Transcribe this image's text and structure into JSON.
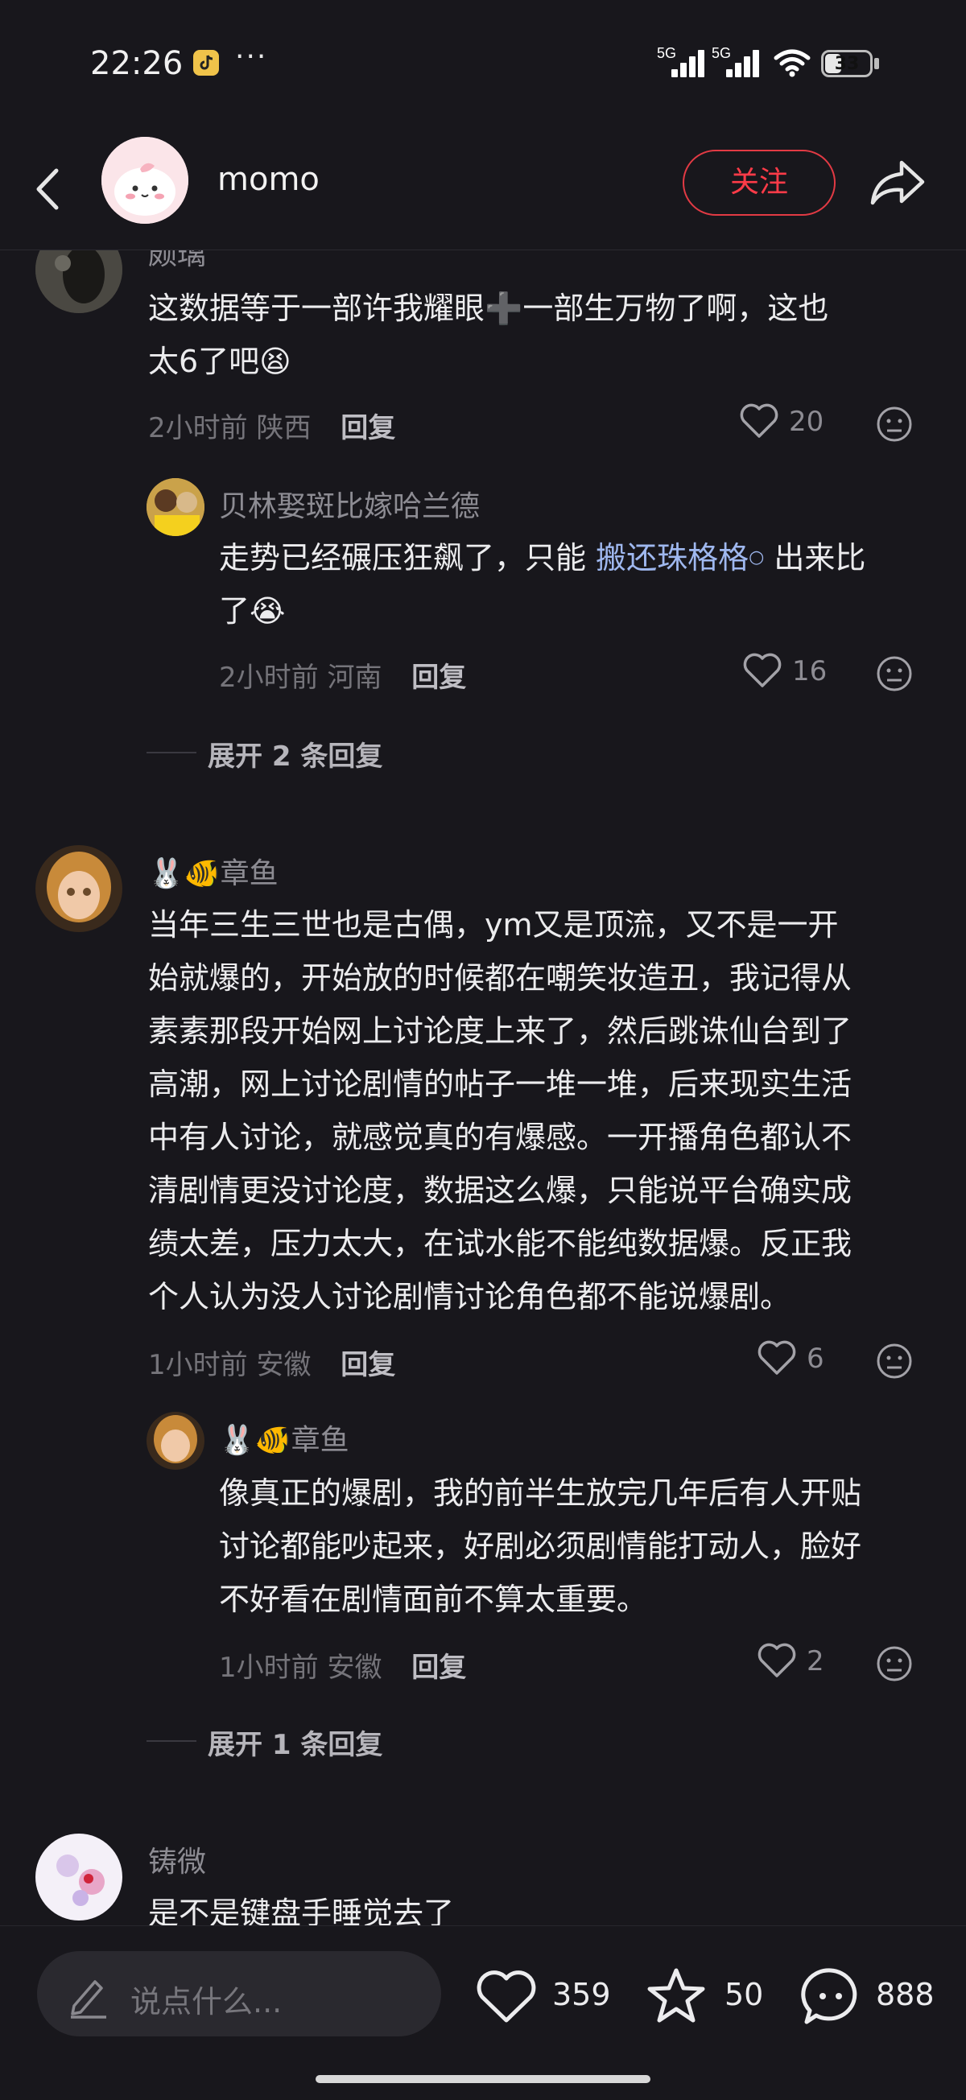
{
  "status_bar": {
    "time": "22:26",
    "network1": "5G",
    "network2": "5G",
    "battery": "33",
    "app_icon": "tiktok-icon"
  },
  "header": {
    "username": "momo",
    "follow_label": "关注"
  },
  "comments": [
    {
      "username": "颇璃",
      "text_line1": "这数据等于一部许我耀眼➕一部生万物了啊，这也",
      "text_line2": "太6了吧😫",
      "time": "2小时前",
      "location": "陕西",
      "reply_label": "回复",
      "likes": "20",
      "reply": {
        "username": "贝林娶斑比嫁哈兰德",
        "text_prefix": "走势已经碾压狂飙了，只能",
        "link": "搬还珠格格",
        "text_suffix": "出来比",
        "text_line2": "了😭",
        "time": "2小时前",
        "location": "河南",
        "reply_label": "回复",
        "likes": "16"
      },
      "expand_label": "展开 2 条回复"
    },
    {
      "username": "🐰🐠章鱼",
      "lines": [
        "当年三生三世也是古偶，ym又是顶流，又不是一开",
        "始就爆的，开始放的时候都在嘲笑妆造丑，我记得从",
        "素素那段开始网上讨论度上来了，然后跳诛仙台到了",
        "高潮，网上讨论剧情的帖子一堆一堆，后来现实生活",
        "中有人讨论，就感觉真的有爆感。一开播角色都认不",
        "清剧情更没讨论度，数据这么爆，只能说平台确实成",
        "绩太差，压力太大，在试水能不能纯数据爆。反正我",
        "个人认为没人讨论剧情讨论角色都不能说爆剧。"
      ],
      "time": "1小时前",
      "location": "安徽",
      "reply_label": "回复",
      "likes": "6",
      "reply": {
        "username": "🐰🐠章鱼",
        "lines": [
          "像真正的爆剧，我的前半生放完几年后有人开贴",
          "讨论都能吵起来，好剧必须剧情能打动人，脸好",
          "不好看在剧情面前不算太重要。"
        ],
        "time": "1小时前",
        "location": "安徽",
        "reply_label": "回复",
        "likes": "2"
      },
      "expand_label": "展开 1 条回复"
    },
    {
      "username": "铸微",
      "text_line1": "是不是键盘手睡觉去了"
    }
  ],
  "bottom_bar": {
    "input_placeholder": "说点什么...",
    "likes": "359",
    "favorites": "50",
    "comments": "888"
  },
  "colors": {
    "background": "#18171c",
    "follow_red": "#ff3b48",
    "link_blue": "#9fb8ef"
  }
}
